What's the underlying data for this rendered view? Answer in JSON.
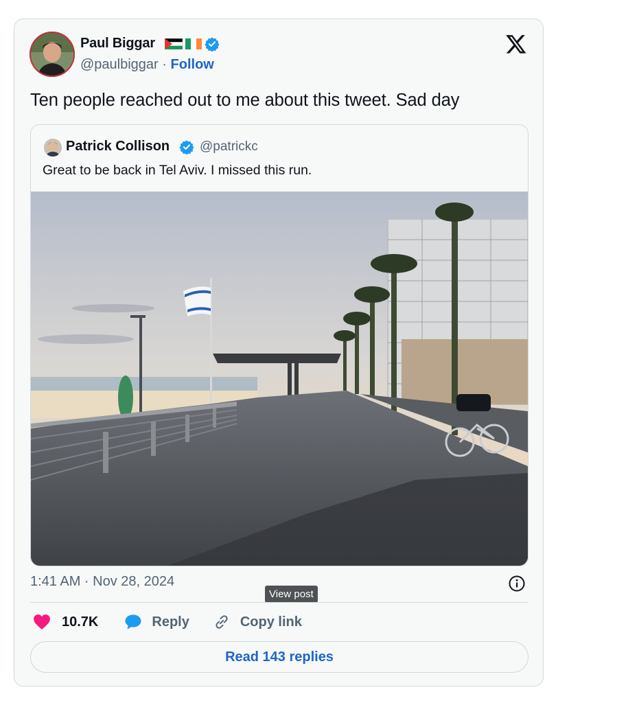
{
  "author": {
    "name": "Paul Biggar",
    "handle": "@paulbiggar",
    "separator": "·",
    "follow_label": "Follow",
    "flags": [
      "palestine-flag",
      "ireland-flag"
    ],
    "verified_icon": "verified-badge-icon"
  },
  "brand_icon": "x-logo-icon",
  "tweet": {
    "text": "Ten people reached out to me about this tweet. Sad day",
    "timestamp": "1:41 AM · Nov 28, 2024"
  },
  "quoted": {
    "name": "Patrick Collison",
    "handle": "@patrickc",
    "text": "Great to be back in Tel Aviv. I missed this run.",
    "image_icon": "beach-promenade-photo"
  },
  "tooltip": "View post",
  "actions": {
    "like_count": "10.7K",
    "reply_label": "Reply",
    "copy_label": "Copy link"
  },
  "read_replies_label": "Read 143 replies",
  "colors": {
    "link": "#1d65c9",
    "heart": "#f91880",
    "reply_bubble": "#1d9bf0",
    "verified": "#1d9bf0",
    "card_bg": "#f7f9f9",
    "border": "#cfd9de",
    "muted": "#536471"
  }
}
